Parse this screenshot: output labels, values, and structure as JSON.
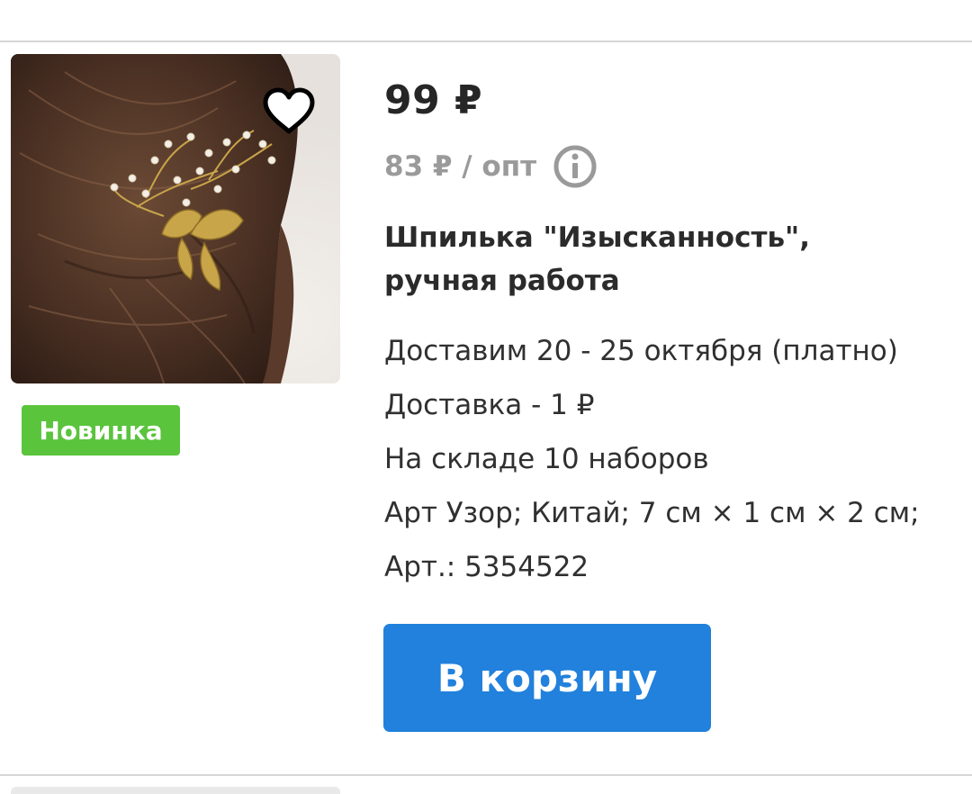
{
  "product": {
    "price": "99 ₽",
    "wholesale_price": "83 ₽ / опт",
    "title_line1": "Шпилька \"Изысканность\",",
    "title_line2": "ручная работа",
    "delivery_date": "Доставим 20 - 25 октября (платно)",
    "delivery_cost": "Доставка - 1 ₽",
    "stock": "На складе 10 наборов",
    "specs": "Арт Узор; Китай; 7 см × 1 см × 2 см;",
    "article": "Арт.: 5354522",
    "badge": "Новинка",
    "add_to_cart_label": "В корзину",
    "image_icon": "hairpin-photo",
    "favorite_icon": "heart-outline-icon",
    "info_icon": "info-circle-icon"
  },
  "colors": {
    "badge": "#5ac43c",
    "button": "#2181dc",
    "muted": "#9a9a9a"
  }
}
